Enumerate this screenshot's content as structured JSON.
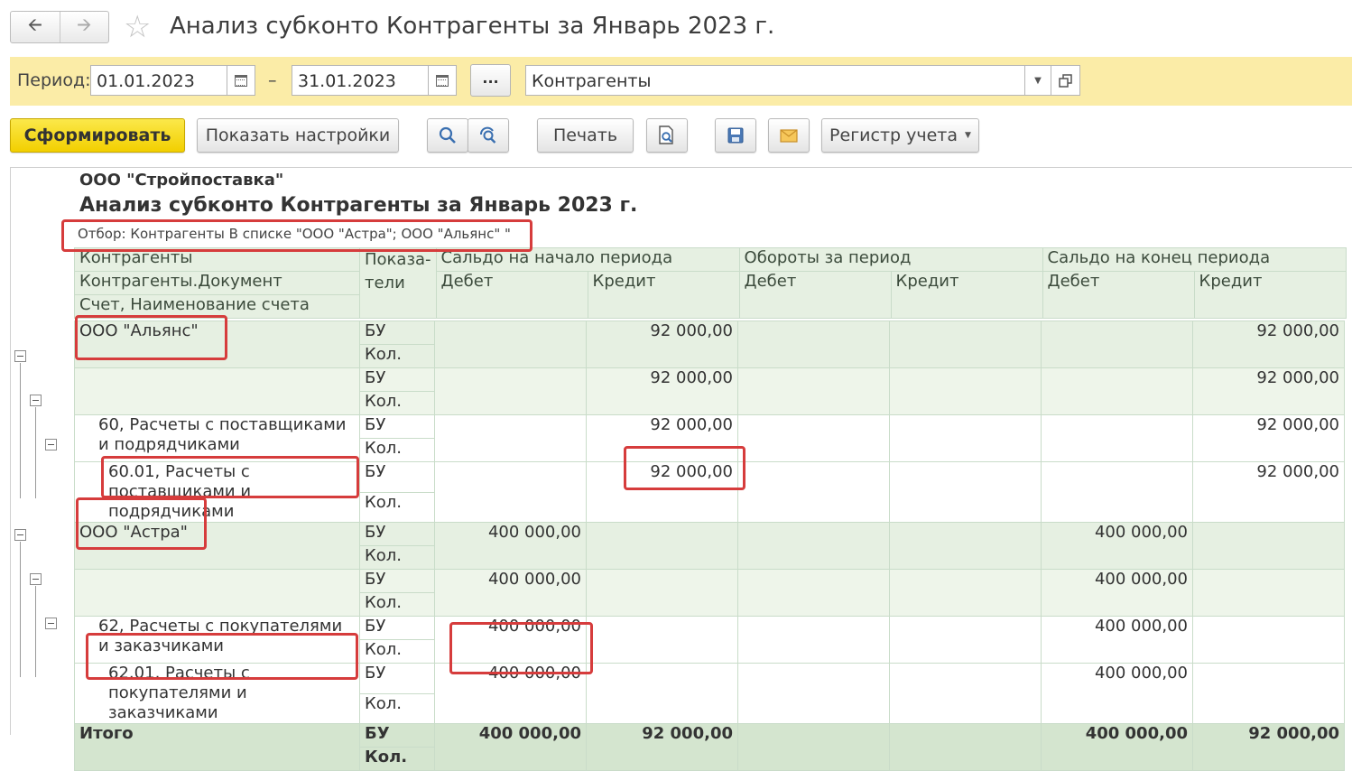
{
  "window": {
    "title": "Анализ субконто Контрагенты за Январь 2023 г.",
    "back_icon": "arrow-left-icon",
    "forward_icon": "arrow-right-icon",
    "favorite_icon": "star-icon"
  },
  "period": {
    "label": "Период:",
    "from": "01.01.2023",
    "dash": "–",
    "to": "31.01.2023",
    "more_label": "...",
    "subconto_value": "Контрагенты"
  },
  "toolbar": {
    "generate": "Сформировать",
    "show_settings": "Показать настройки",
    "print": "Печать",
    "register": "Регистр учета"
  },
  "report": {
    "organization": "ООО \"Стройпоставка\"",
    "title": "Анализ субконто Контрагенты за Январь 2023 г.",
    "filter": "Отбор: Контрагенты В списке \"ООО \"Астра\"; ООО \"Альянс\" \"",
    "header": {
      "col1_line1": "Контрагенты",
      "col1_line2": "Контрагенты.Документ",
      "col1_line3": "Счет, Наименование счета",
      "indicators": "Показа-\nтели",
      "opening": "Сальдо на начало периода",
      "turnover": "Обороты за период",
      "closing": "Сальдо на конец периода",
      "debit": "Дебет",
      "credit": "Кредит"
    },
    "ind_bu": "БУ",
    "ind_qty": "Кол.",
    "rows": [
      {
        "name": "ООО \"Альянс\"",
        "open_d": "",
        "open_c": "92 000,00",
        "turn_d": "",
        "turn_c": "",
        "close_d": "",
        "close_c": "92 000,00"
      },
      {
        "name": "",
        "open_d": "",
        "open_c": "92 000,00",
        "turn_d": "",
        "turn_c": "",
        "close_d": "",
        "close_c": "92 000,00"
      },
      {
        "name": "60, Расчеты с поставщиками и подрядчиками",
        "open_d": "",
        "open_c": "92 000,00",
        "turn_d": "",
        "turn_c": "",
        "close_d": "",
        "close_c": "92 000,00"
      },
      {
        "name": "60.01, Расчеты с поставщиками и подрядчиками",
        "open_d": "",
        "open_c": "92 000,00",
        "turn_d": "",
        "turn_c": "",
        "close_d": "",
        "close_c": "92 000,00"
      },
      {
        "name": "ООО \"Астра\"",
        "open_d": "400 000,00",
        "open_c": "",
        "turn_d": "",
        "turn_c": "",
        "close_d": "400 000,00",
        "close_c": ""
      },
      {
        "name": "",
        "open_d": "400 000,00",
        "open_c": "",
        "turn_d": "",
        "turn_c": "",
        "close_d": "400 000,00",
        "close_c": ""
      },
      {
        "name": "62, Расчеты с покупателями и заказчиками",
        "open_d": "400 000,00",
        "open_c": "",
        "turn_d": "",
        "turn_c": "",
        "close_d": "400 000,00",
        "close_c": ""
      },
      {
        "name": "62.01, Расчеты с покупателями и заказчиками",
        "open_d": "400 000,00",
        "open_c": "",
        "turn_d": "",
        "turn_c": "",
        "close_d": "400 000,00",
        "close_c": ""
      }
    ],
    "total": {
      "name": "Итого",
      "open_d": "400 000,00",
      "open_c": "92 000,00",
      "close_d": "400 000,00",
      "close_c": "92 000,00"
    }
  },
  "colors": {
    "period_bar": "#fbeca7",
    "primary_button": "#f2cf00",
    "row_green": "#e6f0e2",
    "total_green": "#d4e5cf",
    "highlight": "#d63c3c"
  }
}
